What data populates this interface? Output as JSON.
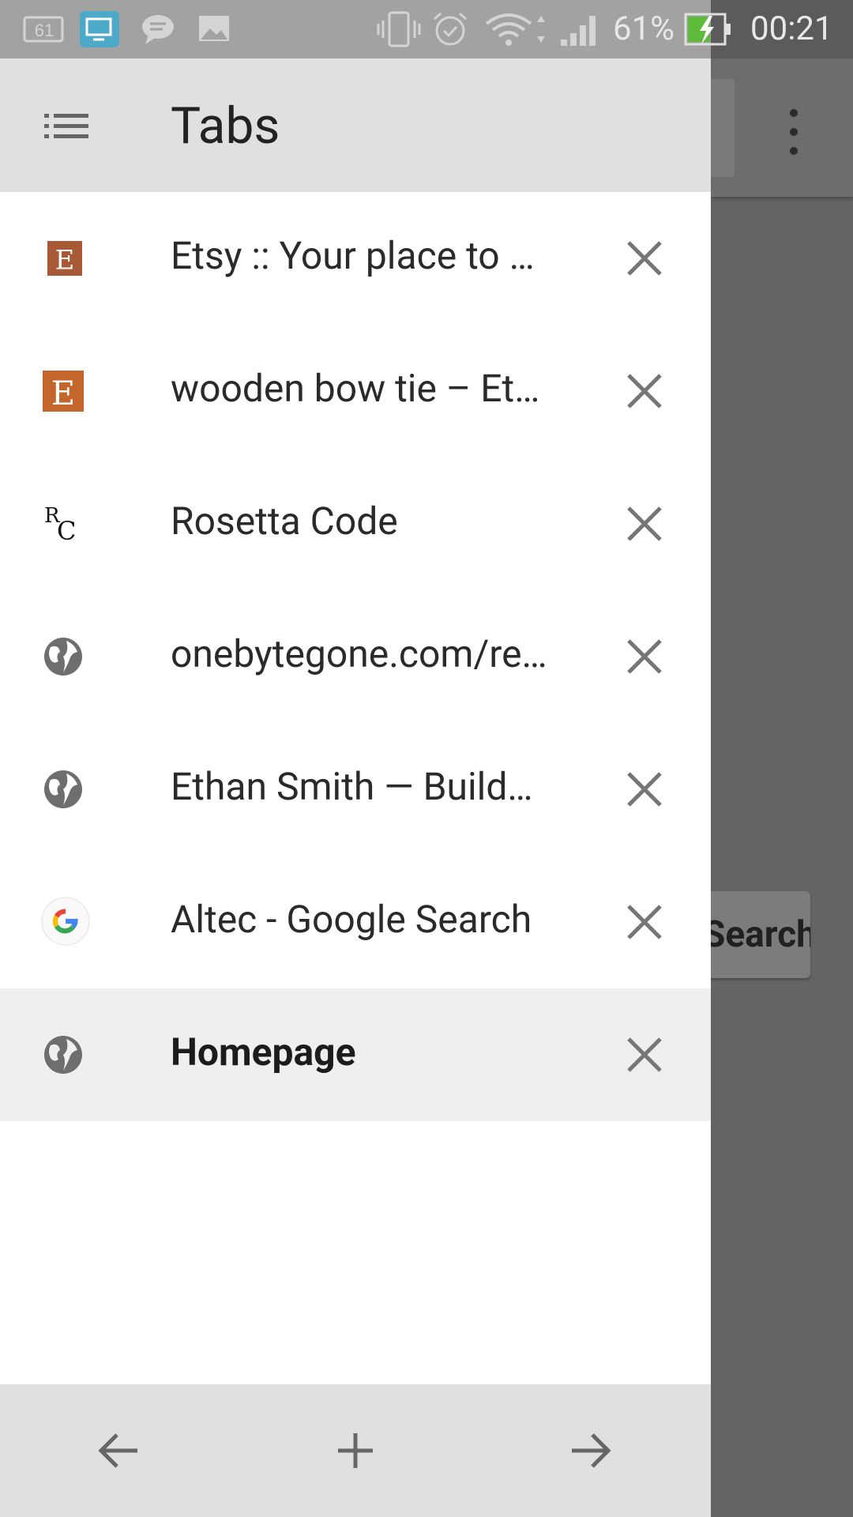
{
  "status_bar": {
    "battery_percent": "61%",
    "time": "00:21",
    "notification_badge": "61"
  },
  "drawer": {
    "title": "Tabs"
  },
  "tabs": [
    {
      "title": "Etsy :: Your place to b…",
      "icon": "etsy-icon",
      "active": false
    },
    {
      "title": "wooden bow tie – Etsy",
      "icon": "etsy-icon",
      "active": false
    },
    {
      "title": "Rosetta Code",
      "icon": "rosetta-code-icon",
      "active": false
    },
    {
      "title": "onebytegone.com/re…",
      "icon": "globe-icon",
      "active": false
    },
    {
      "title": "Ethan Smith — Builde…",
      "icon": "globe-icon",
      "active": false
    },
    {
      "title": "Altec - Google Search",
      "icon": "google-icon",
      "active": false
    },
    {
      "title": "Homepage",
      "icon": "globe-icon",
      "active": true
    }
  ],
  "background_app": {
    "search_button_label": "Search"
  },
  "colors": {
    "drawer_header": "#e0e0e0",
    "active_row": "#efefef",
    "etsy_orange": "#c4652c",
    "scrim": "#606060"
  }
}
